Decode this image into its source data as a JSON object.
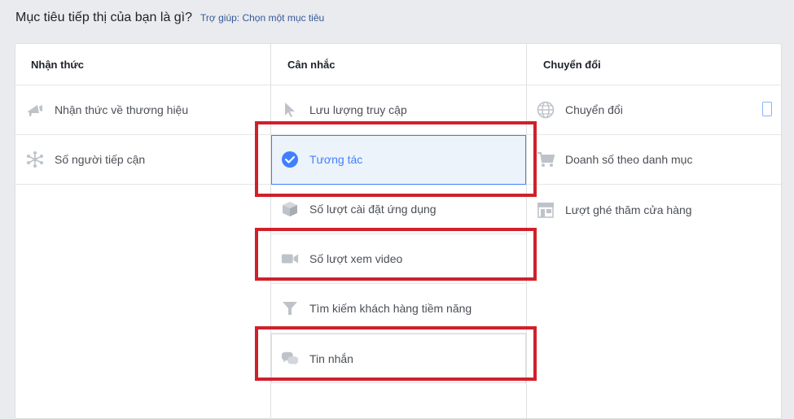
{
  "header": {
    "question": "Mục tiêu tiếp thị của bạn là gì?",
    "help": "Trợ giúp: Chọn một mục tiêu"
  },
  "columns": [
    {
      "title": "Nhận thức",
      "items": [
        {
          "label": "Nhận thức về thương hiệu",
          "icon": "megaphone-icon"
        },
        {
          "label": "Số người tiếp cận",
          "icon": "reach-icon"
        }
      ]
    },
    {
      "title": "Cân nhắc",
      "items": [
        {
          "label": "Lưu lượng truy cập",
          "icon": "cursor-icon"
        },
        {
          "label": "Tương tác",
          "icon": "check-circle-icon",
          "selected": true
        },
        {
          "label": "Số lượt cài đặt ứng dụng",
          "icon": "box-icon"
        },
        {
          "label": "Số lượt xem video",
          "icon": "video-camera-icon"
        },
        {
          "label": "Tìm kiếm khách hàng tiềm năng",
          "icon": "funnel-icon"
        },
        {
          "label": "Tin nhắn",
          "icon": "chat-bubbles-icon"
        }
      ]
    },
    {
      "title": "Chuyển đổi",
      "items": [
        {
          "label": "Chuyển đổi",
          "icon": "globe-icon"
        },
        {
          "label": "Doanh số theo danh mục",
          "icon": "cart-icon"
        },
        {
          "label": "Lượt ghé thăm cửa hàng",
          "icon": "store-icon"
        }
      ]
    }
  ],
  "colors": {
    "selected": "#4080ff",
    "highlight": "#d0202a",
    "icon": "#bec3c9"
  }
}
